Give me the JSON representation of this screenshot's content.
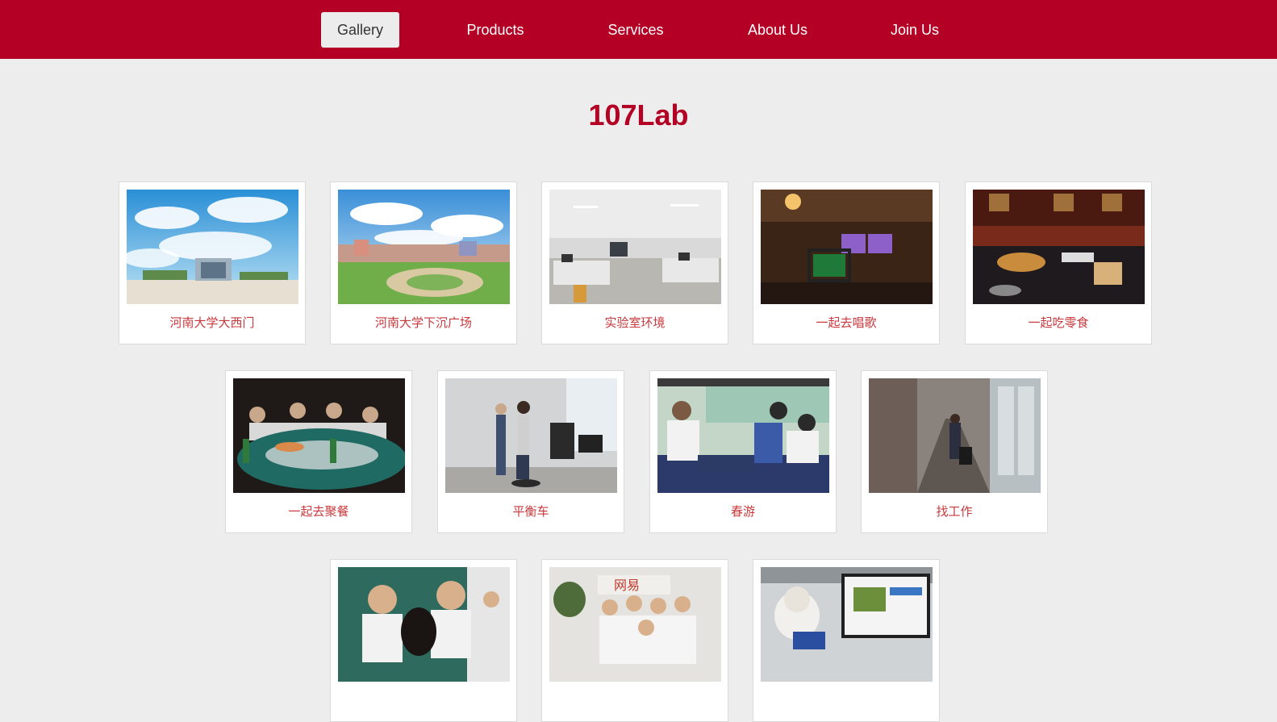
{
  "nav": {
    "items": [
      {
        "label": "Gallery",
        "active": true
      },
      {
        "label": "Products"
      },
      {
        "label": "Services"
      },
      {
        "label": "About Us"
      },
      {
        "label": "Join Us"
      }
    ]
  },
  "page": {
    "title": "107Lab"
  },
  "gallery": [
    {
      "caption": "河南大学大西门",
      "image": "campus-gate-sky"
    },
    {
      "caption": "河南大学下沉广场",
      "image": "sunken-plaza"
    },
    {
      "caption": "实验室环境",
      "image": "lab-room"
    },
    {
      "caption": "一起去唱歌",
      "image": "karaoke-room"
    },
    {
      "caption": "一起吃零食",
      "image": "snacks-table"
    },
    {
      "caption": "一起去聚餐",
      "image": "group-dinner"
    },
    {
      "caption": "平衡车",
      "image": "balance-scooter"
    },
    {
      "caption": "春游",
      "image": "bus-trip"
    },
    {
      "caption": "找工作",
      "image": "corridor-luggage"
    },
    {
      "caption": "",
      "image": "group-selfie"
    },
    {
      "caption": "",
      "image": "company-visit"
    },
    {
      "caption": "",
      "image": "desk-monitor"
    }
  ],
  "colors": {
    "brand": "#b30024",
    "caption": "#c8383c",
    "background": "#ededed"
  }
}
